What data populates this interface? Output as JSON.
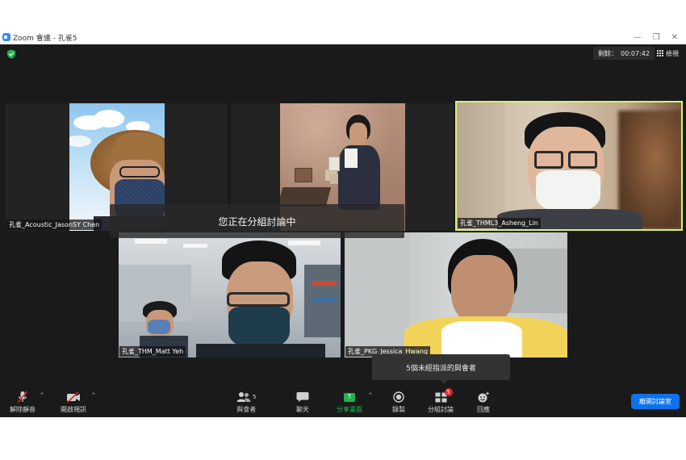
{
  "window": {
    "title": "Zoom 會議 - 孔雀5",
    "controls": [
      "—",
      "❐",
      "✕"
    ]
  },
  "header": {
    "remaining_label": "剩餘：",
    "remaining_time": "00:07:42",
    "view_label": "檢視"
  },
  "participants_tiles": [
    {
      "name": "孔雀_Acoustic_JasonSY Chen"
    },
    {
      "name": "孔雀_THML3_Asheng_Lin"
    },
    {
      "name": "孔雀_THM_Matt Yeh"
    },
    {
      "name": "孔雀_PKG_Jessica_Hwang"
    }
  ],
  "banner": {
    "text": "您正在分組討論中"
  },
  "tooltip": {
    "text": "5個未經指派的與會者"
  },
  "toolbar": {
    "unmute": "解除靜音",
    "start_video": "開啟視訊",
    "participants": "與會者",
    "participants_count": "5",
    "chat": "聊天",
    "share_screen": "分享畫面",
    "record": "錄製",
    "breakout": "分組討論",
    "breakout_badge": "5",
    "reactions": "回應",
    "leave_room": "離開討論室"
  },
  "colors": {
    "accent": "#0e72ed",
    "active_speaker": "#d8f26a",
    "share_green": "#22b14c",
    "badge_red": "#e02828"
  }
}
